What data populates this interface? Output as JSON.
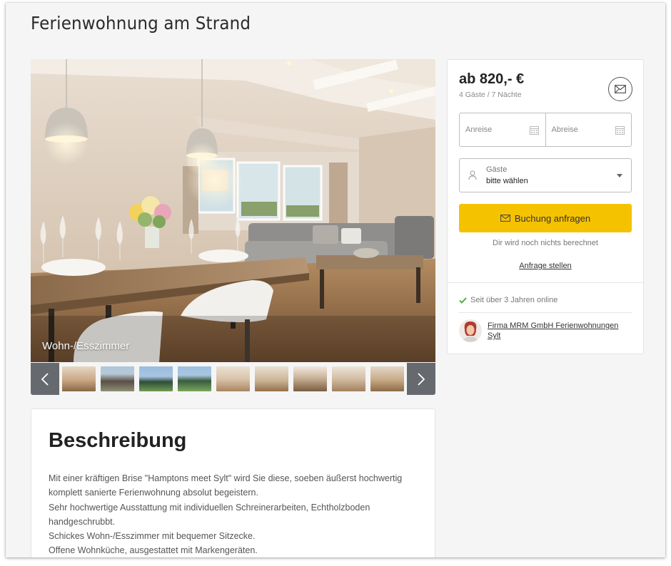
{
  "page": {
    "title": "Ferienwohnung am Strand"
  },
  "gallery": {
    "caption": "Wohn-/Esszimmer",
    "prev_icon": "chevron-left-icon",
    "next_icon": "chevron-right-icon",
    "thumbnail_count": 9
  },
  "booking": {
    "price": "ab 820,- €",
    "price_sub": "4 Gäste / 7 Nächte",
    "arrival_placeholder": "Anreise",
    "departure_placeholder": "Abreise",
    "guests_label": "Gäste",
    "guests_value": "bitte wählen",
    "book_label": "Buchung anfragen",
    "no_charge_text": "Dir wird noch nichts berechnet",
    "inquiry_link": "Anfrage stellen",
    "online_text": "Seit über 3 Jahren online",
    "owner_name": "Firma MRM GmbH Ferienwohnungen Sylt",
    "accent_color": "#f5c200",
    "check_color": "#4caf3a"
  },
  "description": {
    "title": "Beschreibung",
    "lines": [
      "Mit einer kräftigen Brise \"Hamptons meet Sylt\" wird Sie diese, soeben äußerst hochwertig",
      "komplett sanierte Ferienwohnung absolut begeistern.",
      "Sehr hochwertige Ausstattung mit individuellen Schreinerarbeiten, Echtholzboden",
      "handgeschrubbt.",
      "Schickes Wohn-/Esszimmer mit bequemer Sitzecke.",
      "Offene Wohnküche, ausgestattet mit Markengeräten."
    ]
  }
}
